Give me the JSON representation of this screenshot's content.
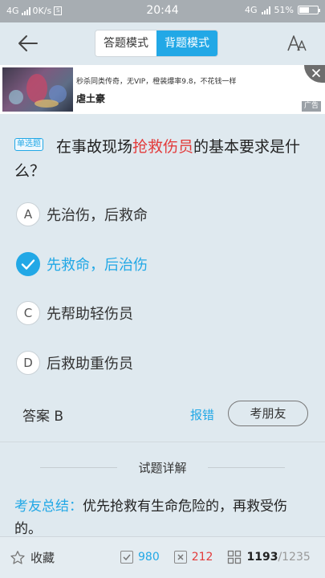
{
  "statusbar": {
    "network_left": "4G",
    "speed": "0K/s",
    "sim_icon_label": "S",
    "time": "20:44",
    "network_right": "4G",
    "battery": "51%"
  },
  "header": {
    "mode_answer": "答题模式",
    "mode_memory": "背题模式"
  },
  "ad": {
    "line1": "秒杀同类传奇，无VIP，橙装爆率9.8，不花钱一样",
    "line2": "虐土豪",
    "tag": "广告"
  },
  "question": {
    "type_badge": "单选题",
    "text_before": "在事故现场",
    "text_highlight": "抢救伤员",
    "text_after": "的基本要求是什么？",
    "options": [
      {
        "letter": "A",
        "text": "先治伤，后救命"
      },
      {
        "letter": "B",
        "text": "先救命，后治伤"
      },
      {
        "letter": "C",
        "text": "先帮助轻伤员"
      },
      {
        "letter": "D",
        "text": "后救助重伤员"
      }
    ],
    "answer_label": "答案  B",
    "report": "报错",
    "ask_friend": "考朋友"
  },
  "detail": {
    "title": "试题详解",
    "summary_label": "考友总结：",
    "summary_text": "优先抢救有生命危险的，再救受伤的。"
  },
  "bottombar": {
    "favorite": "收藏",
    "correct_count": "980",
    "wrong_count": "212",
    "progress_current": "1193",
    "progress_total": "/1235"
  },
  "colors": {
    "accent": "#22a8e6",
    "highlight_red": "#e33b3b",
    "background": "#dfe9ef"
  },
  "icons": [
    "back-arrow-icon",
    "font-size-icon",
    "close-icon",
    "check-icon",
    "star-icon",
    "checkbox-check-icon",
    "checkbox-cross-icon",
    "grid-icon"
  ]
}
